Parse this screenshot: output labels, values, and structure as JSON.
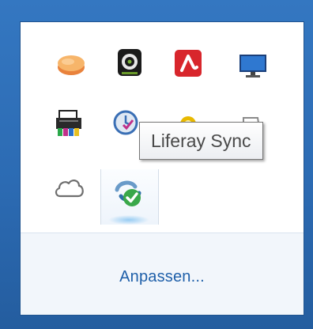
{
  "tray": {
    "icons": [
      {
        "name": "disc-icon",
        "color": "#f5a85a"
      },
      {
        "name": "webcam-icon",
        "color": "#1c1c1c"
      },
      {
        "name": "avira-icon",
        "color": "#d8262c"
      },
      {
        "name": "monitor-icon",
        "color": "#1f5db0"
      },
      {
        "name": "printer-icon",
        "color": "#333333"
      },
      {
        "name": "clock-check-icon",
        "color": "#3a7bc8"
      },
      {
        "name": "partial-yellow-icon",
        "color": "#e8b900"
      },
      {
        "name": "partial-gray-icon",
        "color": "#8a8a8a"
      },
      {
        "name": "cloud-icon",
        "color": "#7a7a7a"
      },
      {
        "name": "liferay-sync-icon",
        "color": "#4aa84a"
      }
    ],
    "tooltip": "Liferay Sync",
    "customize_label": "Anpassen..."
  }
}
